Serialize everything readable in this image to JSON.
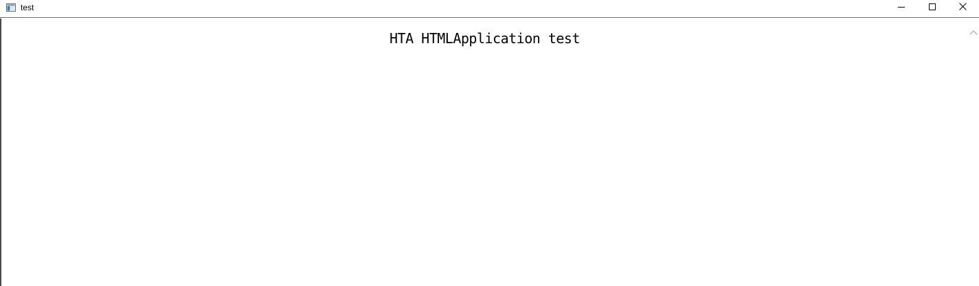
{
  "window": {
    "title": "test",
    "icon": "app-window-icon"
  },
  "caption_buttons": {
    "minimize": "minimize-icon",
    "maximize": "maximize-icon",
    "close": "close-icon"
  },
  "content": {
    "heading": "HTA HTMLApplication test"
  },
  "scrollbar": {
    "up_arrow": "chevron-up-icon"
  }
}
